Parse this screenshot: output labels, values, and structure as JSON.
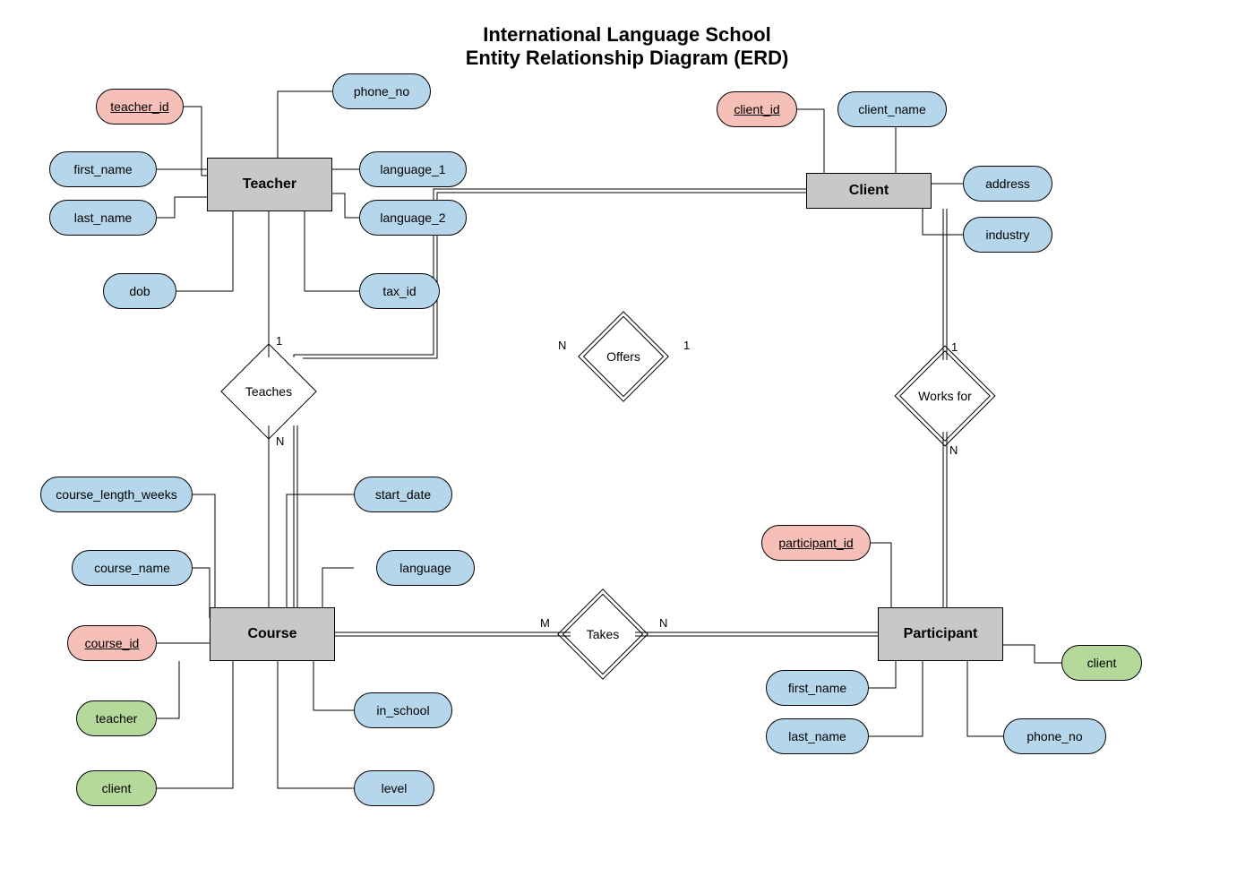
{
  "title": {
    "line1": "International Language School",
    "line2": "Entity Relationship Diagram (ERD)"
  },
  "entities": {
    "teacher": "Teacher",
    "client": "Client",
    "course": "Course",
    "participant": "Participant"
  },
  "relationships": {
    "teaches": "Teaches",
    "offers": "Offers",
    "worksfor": "Works for",
    "takes": "Takes"
  },
  "attrs": {
    "teacher": {
      "teacher_id": "teacher_id",
      "first_name": "first_name",
      "last_name": "last_name",
      "dob": "dob",
      "phone_no": "phone_no",
      "language_1": "language_1",
      "language_2": "language_2",
      "tax_id": "tax_id"
    },
    "client": {
      "client_id": "client_id",
      "client_name": "client_name",
      "address": "address",
      "industry": "industry"
    },
    "course": {
      "course_length_weeks": "course_length_weeks",
      "course_name": "course_name",
      "course_id": "course_id",
      "teacher": "teacher",
      "client": "client",
      "start_date": "start_date",
      "language": "language",
      "in_school": "in_school",
      "level": "level"
    },
    "participant": {
      "participant_id": "participant_id",
      "first_name": "first_name",
      "last_name": "last_name",
      "phone_no": "phone_no",
      "client": "client"
    }
  },
  "card": {
    "teaches_top": "1",
    "teaches_bot": "N",
    "offers_left": "N",
    "offers_right": "1",
    "worksfor_top": "1",
    "worksfor_bot": "N",
    "takes_left": "M",
    "takes_right": "N"
  }
}
